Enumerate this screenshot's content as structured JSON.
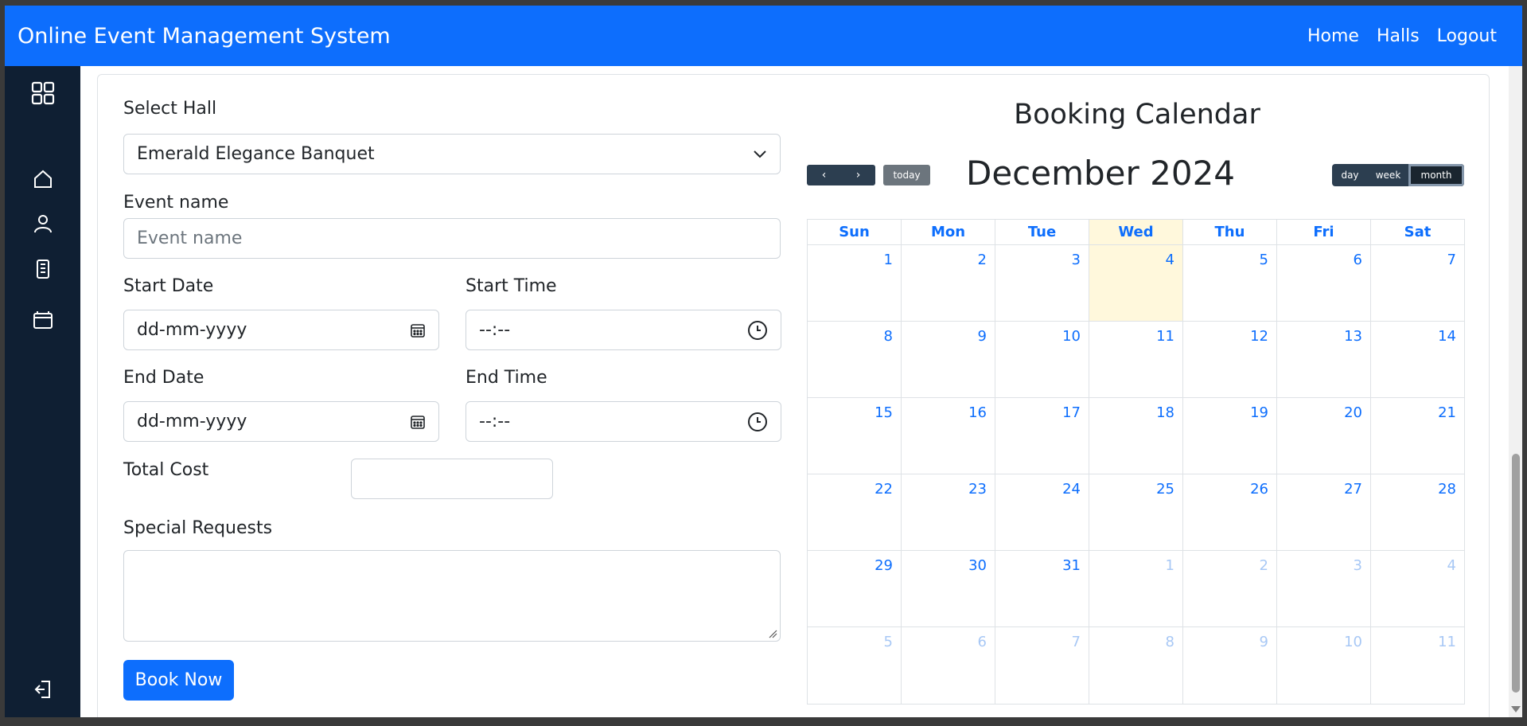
{
  "app": {
    "title": "Online Event Management System"
  },
  "nav": {
    "home": "Home",
    "halls": "Halls",
    "logout": "Logout"
  },
  "sidebar": {
    "icons": [
      "grid-icon",
      "home-icon",
      "user-icon",
      "building-icon",
      "wallet-icon",
      "logout-icon"
    ]
  },
  "form": {
    "select_hall_label": "Select Hall",
    "select_hall_value": "Emerald Elegance Banquet",
    "event_name_label": "Event name",
    "event_name_placeholder": "Event name",
    "start_date_label": "Start Date",
    "start_date_placeholder": "dd-mm-yyyy",
    "start_time_label": "Start Time",
    "start_time_placeholder": "--:--",
    "end_date_label": "End Date",
    "end_date_placeholder": "dd-mm-yyyy",
    "end_time_label": "End Time",
    "end_time_placeholder": "--:--",
    "total_cost_label": "Total Cost",
    "total_cost_value": "",
    "special_requests_label": "Special Requests",
    "special_requests_value": "",
    "book_button": "Book Now"
  },
  "calendar": {
    "heading": "Booking Calendar",
    "month_title": "December 2024",
    "prev": "‹",
    "next": "›",
    "today": "today",
    "views": {
      "day": "day",
      "week": "week",
      "month": "month"
    },
    "active_view": "month",
    "weekdays": [
      "Sun",
      "Mon",
      "Tue",
      "Wed",
      "Thu",
      "Fri",
      "Sat"
    ],
    "weeks": [
      [
        {
          "d": "1"
        },
        {
          "d": "2"
        },
        {
          "d": "3"
        },
        {
          "d": "4",
          "today": true
        },
        {
          "d": "5"
        },
        {
          "d": "6"
        },
        {
          "d": "7"
        }
      ],
      [
        {
          "d": "8"
        },
        {
          "d": "9"
        },
        {
          "d": "10"
        },
        {
          "d": "11"
        },
        {
          "d": "12"
        },
        {
          "d": "13"
        },
        {
          "d": "14"
        }
      ],
      [
        {
          "d": "15"
        },
        {
          "d": "16"
        },
        {
          "d": "17"
        },
        {
          "d": "18"
        },
        {
          "d": "19"
        },
        {
          "d": "20"
        },
        {
          "d": "21"
        }
      ],
      [
        {
          "d": "22"
        },
        {
          "d": "23"
        },
        {
          "d": "24"
        },
        {
          "d": "25"
        },
        {
          "d": "26"
        },
        {
          "d": "27"
        },
        {
          "d": "28"
        }
      ],
      [
        {
          "d": "29"
        },
        {
          "d": "30"
        },
        {
          "d": "31"
        },
        {
          "d": "1",
          "other": true
        },
        {
          "d": "2",
          "other": true
        },
        {
          "d": "3",
          "other": true
        },
        {
          "d": "4",
          "other": true
        }
      ],
      [
        {
          "d": "5",
          "other": true
        },
        {
          "d": "6",
          "other": true
        },
        {
          "d": "7",
          "other": true
        },
        {
          "d": "8",
          "other": true
        },
        {
          "d": "9",
          "other": true
        },
        {
          "d": "10",
          "other": true
        },
        {
          "d": "11",
          "other": true
        }
      ]
    ]
  },
  "colors": {
    "primary": "#0d6efd",
    "sidebar": "#0f1f33",
    "today_bg": "#fff8dc",
    "cal_button": "#2c3e50"
  }
}
